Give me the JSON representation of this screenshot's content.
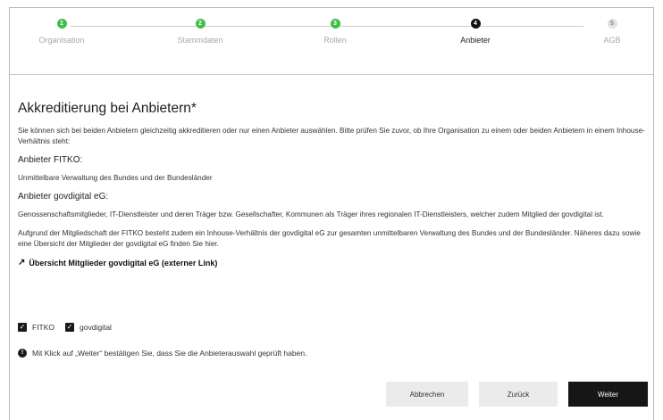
{
  "stepper": {
    "steps": [
      {
        "number": "1",
        "label": "Organisation",
        "state": "done"
      },
      {
        "number": "2",
        "label": "Stammdaten",
        "state": "done"
      },
      {
        "number": "3",
        "label": "Rollen",
        "state": "done"
      },
      {
        "number": "4",
        "label": "Anbieter",
        "state": "active"
      },
      {
        "number": "5",
        "label": "AGB",
        "state": "todo"
      }
    ]
  },
  "main": {
    "title": "Akkreditierung bei Anbietern*",
    "intro": "Sie können sich bei beiden Anbietern gleichzeitig akkreditieren oder nur einen Anbieter auswählen. Bitte prüfen Sie zuvor, ob Ihre Organisation zu einem oder beiden Anbietern in einem Inhouse-Verhältnis steht:",
    "fitko_heading": "Anbieter FITKO:",
    "fitko_text": "Unmittelbare Verwaltung des Bundes und der Bundesländer",
    "govdigital_heading": "Anbieter govdigital eG:",
    "govdigital_text": "Genossenschaftsmitglieder, IT-Dienstleister und deren Träger bzw. Gesellschafter, Kommunen als Träger ihres regionalen IT-Dienstleisters, welcher zudem Mitglied der govdigital ist.",
    "membership_text": "Aufgrund der Mitgliedschaft der FITKO besteht zudem ein Inhouse-Verhältnis der govdigital eG zur gesamten unmittelbaren Verwaltung des Bundes und der Bundesländer. Näheres dazu sowie eine Übersicht der Mitglieder der govdigital eG finden Sie hier.",
    "link_label": "Übersicht Mitglieder govdigital eG (externer Link)"
  },
  "selection": {
    "fitko_label": "FITKO",
    "fitko_checked": true,
    "govdigital_label": "govdigital",
    "govdigital_checked": true
  },
  "notice": {
    "icon": "info-icon",
    "text": "Mit Klick auf „Weiter“ bestätigen Sie, dass Sie die Anbieterauswahl geprüft haben."
  },
  "buttons": {
    "cancel": "Abbrechen",
    "back": "Zurück",
    "next": "Weiter"
  }
}
